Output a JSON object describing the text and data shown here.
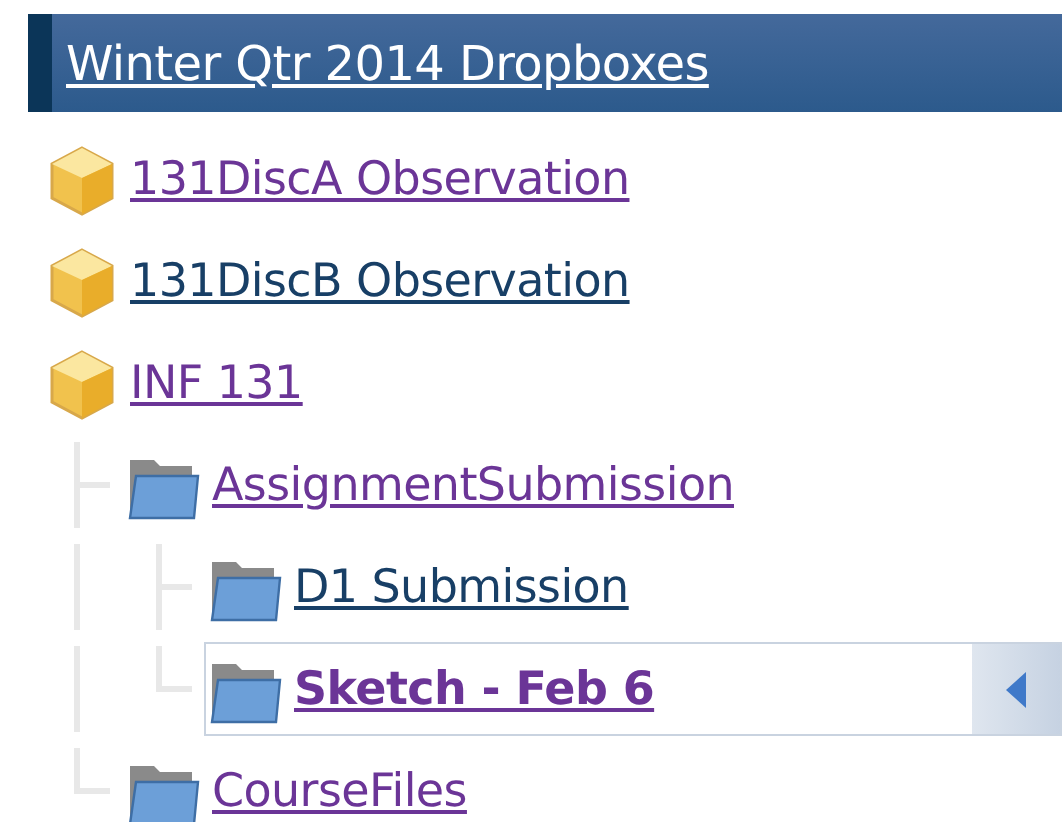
{
  "header": {
    "title": "Winter Qtr 2014 Dropboxes"
  },
  "tree": [
    {
      "label": "131DiscA Observation",
      "kind": "box",
      "visited": true,
      "selected": false
    },
    {
      "label": "131DiscB Observation",
      "kind": "box",
      "visited": false,
      "selected": false
    },
    {
      "label": "INF 131",
      "kind": "box",
      "visited": true,
      "selected": false,
      "children": [
        {
          "label": "AssignmentSubmission",
          "kind": "folder",
          "visited": true,
          "selected": false,
          "children": [
            {
              "label": "D1 Submission",
              "kind": "folder",
              "visited": false,
              "selected": false
            },
            {
              "label": "Sketch - Feb 6",
              "kind": "folder",
              "visited": true,
              "selected": true
            }
          ]
        },
        {
          "label": "CourseFiles",
          "kind": "folder",
          "visited": true,
          "selected": false
        }
      ]
    }
  ]
}
